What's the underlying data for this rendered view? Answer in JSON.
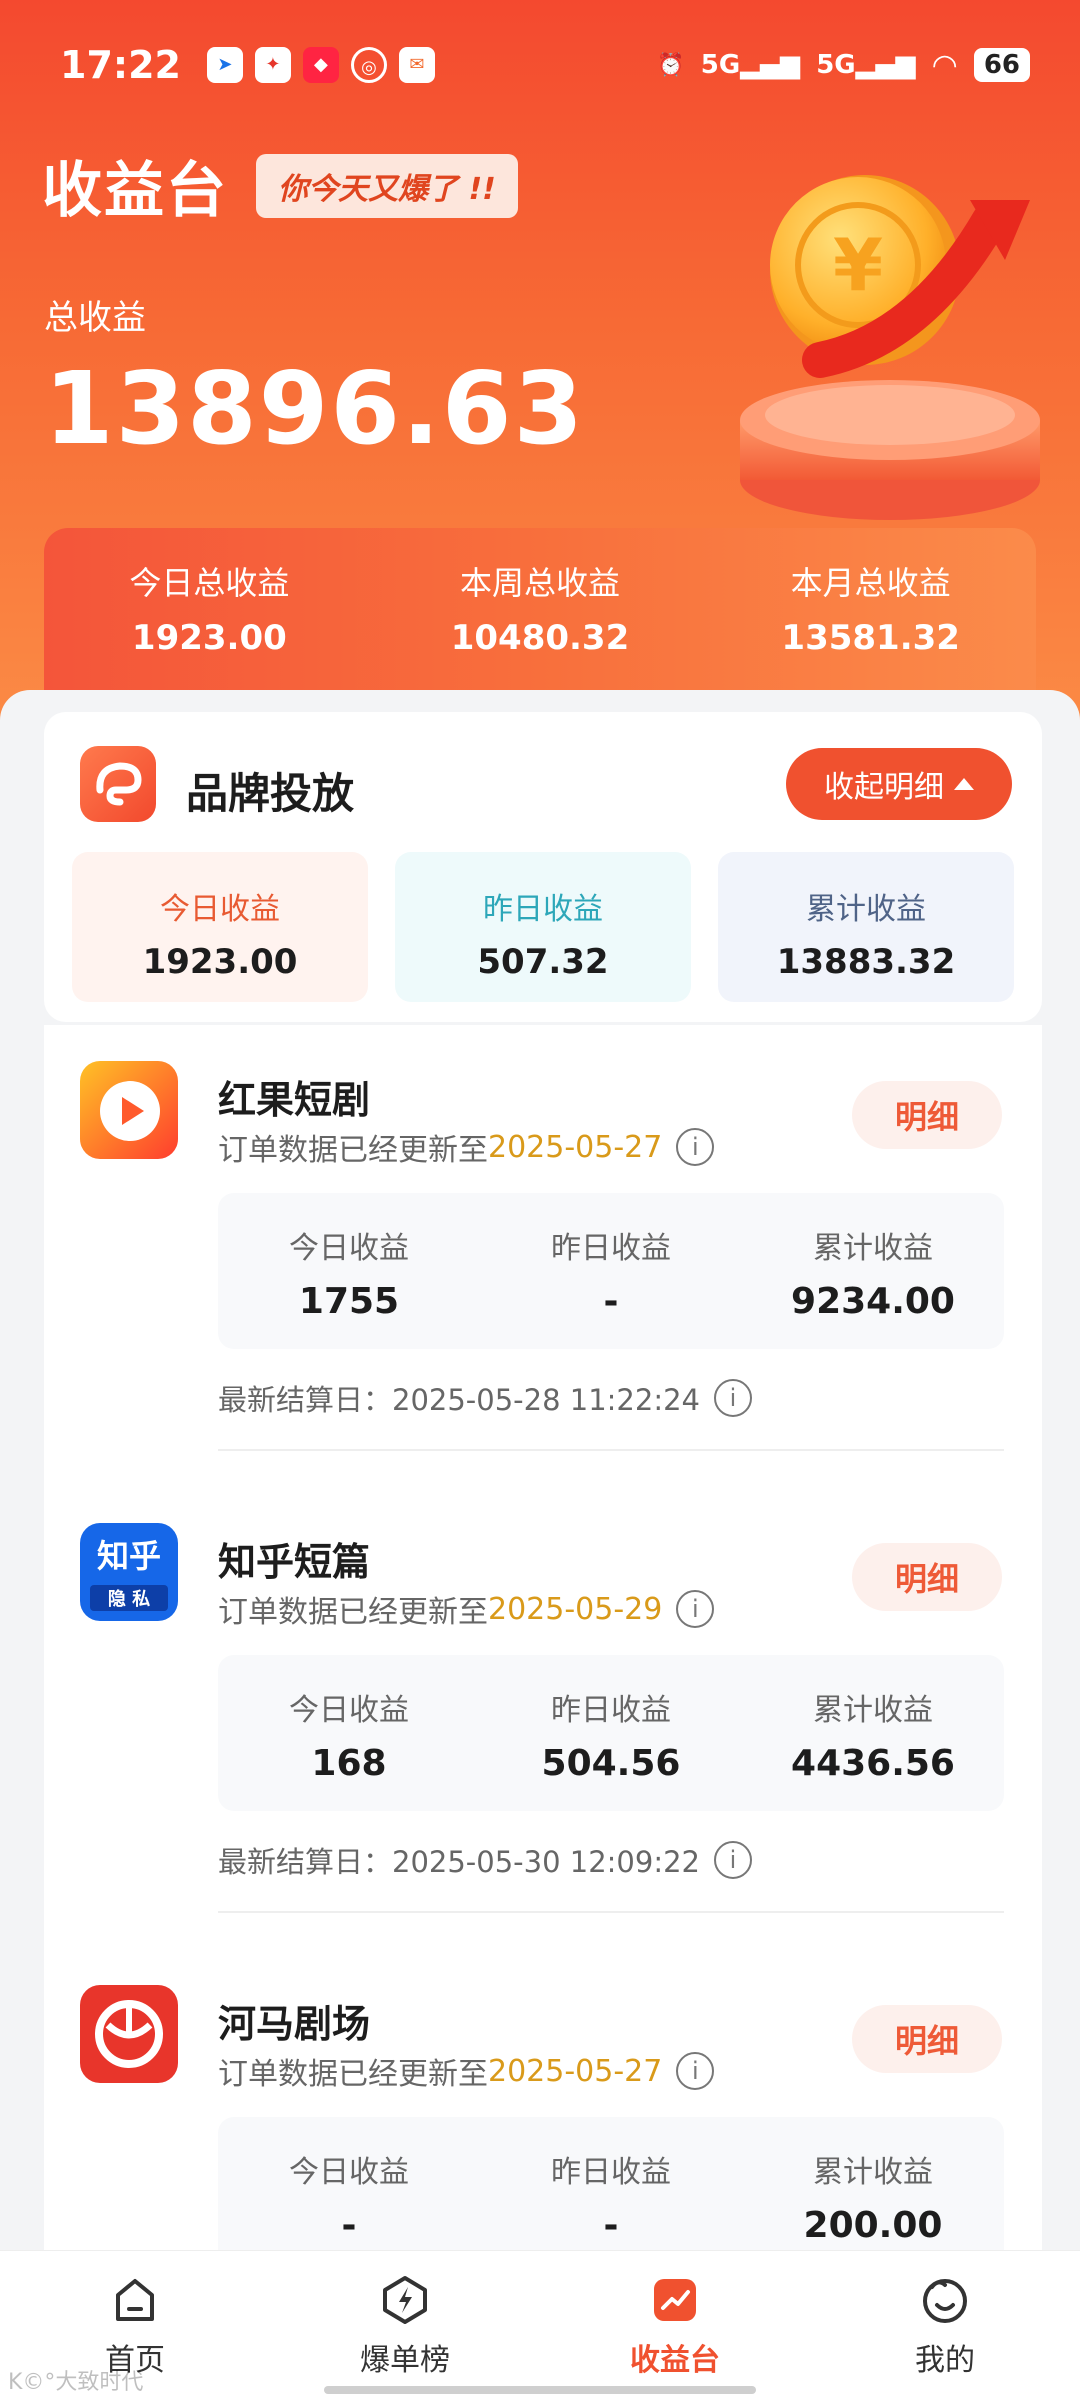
{
  "status_bar": {
    "time": "17:22",
    "network1": "5G",
    "network2": "5G",
    "battery": "66",
    "notif_icons": [
      "map-icon",
      "game-icon",
      "xiaohongshu-icon",
      "netease-icon",
      "mail-icon"
    ]
  },
  "header": {
    "title": "收益台",
    "badge": "你今天又爆了 !!",
    "total_label": "总收益",
    "total_value": "13896.63"
  },
  "summary": {
    "today_label": "今日总收益",
    "today_value": "1923.00",
    "week_label": "本周总收益",
    "week_value": "10480.32",
    "month_label": "本月总收益",
    "month_value": "13581.32"
  },
  "brand": {
    "title": "品牌投放",
    "collapse_label": "收起明细",
    "stats": [
      {
        "label": "今日收益",
        "value": "1923.00"
      },
      {
        "label": "昨日收益",
        "value": "507.32"
      },
      {
        "label": "累计收益",
        "value": "13883.32"
      }
    ]
  },
  "items": [
    {
      "name": "红果短剧",
      "sub_prefix": "订单数据已经更新至",
      "date": "2025-05-27",
      "detail_label": "明细",
      "stats": [
        {
          "label": "今日收益",
          "value": "1755"
        },
        {
          "label": "昨日收益",
          "value": "-"
        },
        {
          "label": "累计收益",
          "value": "9234.00"
        }
      ],
      "settle": "最新结算日：2025-05-28 11:22:24"
    },
    {
      "name": "知乎短篇",
      "icon_text": "知乎",
      "icon_subtext": "隐 私",
      "sub_prefix": "订单数据已经更新至",
      "date": "2025-05-29",
      "detail_label": "明细",
      "stats": [
        {
          "label": "今日收益",
          "value": "168"
        },
        {
          "label": "昨日收益",
          "value": "504.56"
        },
        {
          "label": "累计收益",
          "value": "4436.56"
        }
      ],
      "settle": "最新结算日：2025-05-30 12:09:22"
    },
    {
      "name": "河马剧场",
      "sub_prefix": "订单数据已经更新至",
      "date": "2025-05-27",
      "detail_label": "明细",
      "stats": [
        {
          "label": "今日收益",
          "value": "-"
        },
        {
          "label": "昨日收益",
          "value": "-"
        },
        {
          "label": "累计收益",
          "value": "200.00"
        }
      ],
      "settle": ""
    }
  ],
  "tabbar": [
    {
      "label": "首页",
      "icon": "home-icon"
    },
    {
      "label": "爆单榜",
      "icon": "lightning-icon"
    },
    {
      "label": "收益台",
      "icon": "chart-icon"
    },
    {
      "label": "我的",
      "icon": "profile-icon"
    }
  ],
  "watermark": "K©°大致时代",
  "colors": {
    "accent": "#f0512f",
    "date": "#d99a1a"
  }
}
